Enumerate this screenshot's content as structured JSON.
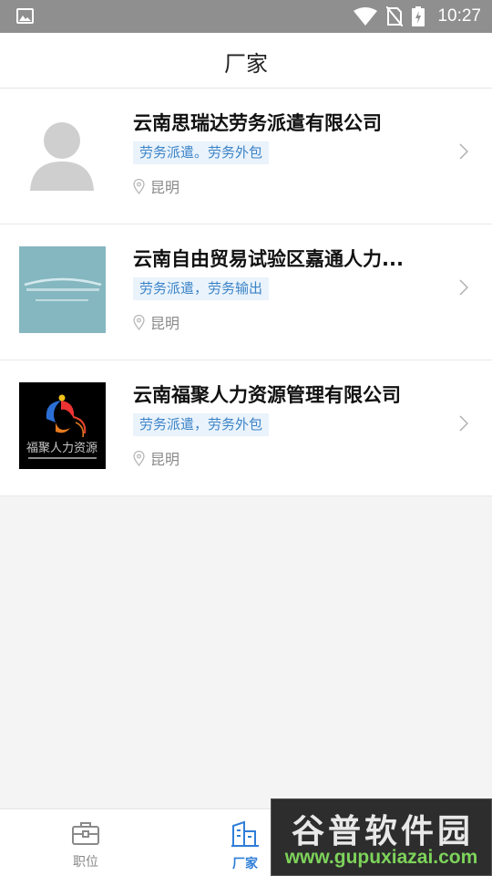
{
  "status_bar": {
    "time": "10:27"
  },
  "header": {
    "title": "厂家"
  },
  "companies": [
    {
      "name": "云南思瑞达劳务派遣有限公司",
      "tags": "劳务派遣。劳务外包",
      "location": "昆明",
      "thumb": "avatar-placeholder"
    },
    {
      "name": "云南自由贸易试验区嘉通人力...",
      "tags": "劳务派遣，劳务输出",
      "location": "昆明",
      "thumb": "company-logo-teal"
    },
    {
      "name": "云南福聚人力资源管理有限公司",
      "tags": "劳务派遣，劳务外包",
      "location": "昆明",
      "thumb": "company-logo-fuju",
      "logo_text": "福聚人力资源"
    }
  ],
  "bottom_nav": {
    "items": [
      {
        "label": "职位",
        "icon": "briefcase-icon",
        "active": false
      },
      {
        "label": "厂家",
        "icon": "building-icon",
        "active": true
      }
    ]
  },
  "watermark": {
    "title": "谷普软件园",
    "url": "www.gupuxiazai.com"
  },
  "colors": {
    "accent": "#2f7ed8",
    "tag_bg": "#eaf3fb",
    "tag_text": "#3b83c8"
  }
}
